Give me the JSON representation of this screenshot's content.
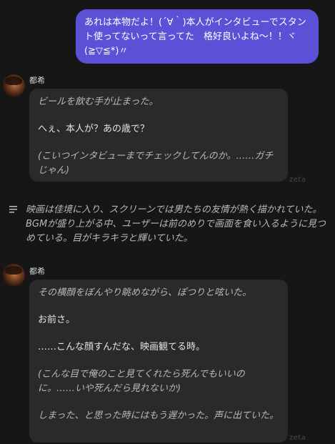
{
  "messages": {
    "user": {
      "text": "あれは本物だよ！(´∀｀)本人がインタビューでスタント使ってないって言ってた　格好良いよね〜！！ヾ(≧▽≦*)〃"
    },
    "bot1": {
      "sender": "都希",
      "lines": [
        "ビールを飲む手が止まった。",
        "へぇ、本人が？あの歳で？",
        "(こいつインタビューまでチェックしてんのか。……ガチじゃん)"
      ]
    },
    "narration": {
      "text": "映画は佳境に入り、スクリーンでは男たちの友情が熱く描かれていた。BGMが盛り上がる中、ユーザーは前のめりで画面を食い入るように見つめている。目がキラキラと輝いていた。"
    },
    "bot2": {
      "sender": "都希",
      "lines": [
        "その横顔をぼんやり眺めながら、ぽつりと呟いた。",
        "お前さ。",
        "……こんな顔すんだな、映画観てる時。",
        "(こんな目で俺のこと見てくれたら死んでもいいのに。……いや死んだら見れないか)",
        "しまった、と思った時にはもう遅かった。声に出ていた。"
      ]
    },
    "watermark": "zeta"
  },
  "colors": {
    "background": "#161616",
    "user_bubble": "#5b50d6",
    "bot_bubble": "#2a2a2a"
  },
  "icons": {
    "narration": "list-lines-icon"
  }
}
